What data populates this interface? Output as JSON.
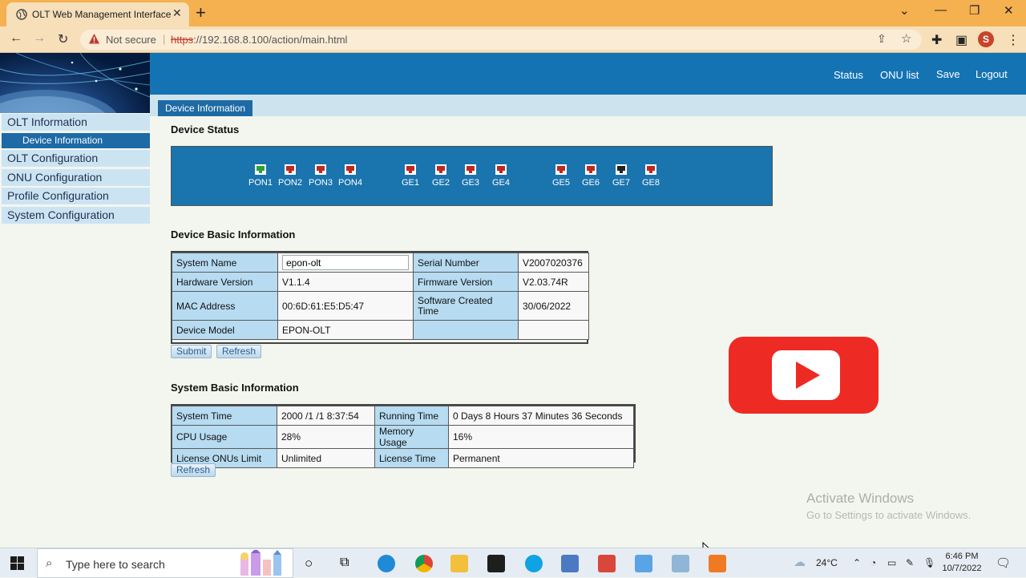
{
  "browser": {
    "tab_title": "OLT Web Management Interface",
    "new_tab": "+",
    "not_secure": "Not secure",
    "url_scheme": "https",
    "url_rest": "://192.168.8.100/action/main.html",
    "profile_initial": "S"
  },
  "header": {
    "links": [
      "Status",
      "ONU list",
      "Save",
      "Logout"
    ],
    "page_tab": "Device Information"
  },
  "sidebar": {
    "items": [
      {
        "label": "OLT Information"
      },
      {
        "label": "Device Information"
      },
      {
        "label": "OLT Configuration"
      },
      {
        "label": "ONU Configuration"
      },
      {
        "label": "Profile Configuration"
      },
      {
        "label": "System Configuration"
      }
    ]
  },
  "device_status": {
    "title": "Device Status",
    "ports": [
      {
        "label": "PON1",
        "state": "up",
        "color": "#2e9e3a"
      },
      {
        "label": "PON2",
        "state": "down",
        "color": "#c0281e"
      },
      {
        "label": "PON3",
        "state": "down",
        "color": "#c0281e"
      },
      {
        "label": "PON4",
        "state": "down",
        "color": "#c0281e"
      },
      {
        "label": "GE1",
        "state": "down",
        "color": "#c0281e"
      },
      {
        "label": "GE2",
        "state": "down",
        "color": "#c0281e"
      },
      {
        "label": "GE3",
        "state": "down",
        "color": "#c0281e"
      },
      {
        "label": "GE4",
        "state": "down",
        "color": "#c0281e"
      },
      {
        "label": "GE5",
        "state": "down",
        "color": "#c0281e"
      },
      {
        "label": "GE6",
        "state": "down",
        "color": "#c0281e"
      },
      {
        "label": "GE7",
        "state": "up",
        "color": "#222222"
      },
      {
        "label": "GE8",
        "state": "down",
        "color": "#c0281e"
      }
    ]
  },
  "device_basic": {
    "title": "Device Basic Information",
    "system_name_label": "System Name",
    "system_name_value": "epon-olt",
    "serial_label": "Serial Number",
    "serial_value": "V2007020376",
    "hw_label": "Hardware Version",
    "hw_value": "V1.1.4",
    "fw_label": "Firmware Version",
    "fw_value": "V2.03.74R",
    "mac_label": "MAC Address",
    "mac_value": "00:6D:61:E5:D5:47",
    "sw_created_label": "Software Created Time",
    "sw_created_value": "30/06/2022",
    "model_label": "Device Model",
    "model_value": "EPON-OLT",
    "submit": "Submit",
    "refresh": "Refresh"
  },
  "system_basic": {
    "title": "System Basic Information",
    "rows": [
      [
        "System Time",
        "2000 /1 /1 8:37:54",
        "Running Time",
        "0 Days 8 Hours 37 Minutes 36 Seconds"
      ],
      [
        "CPU Usage",
        "28%",
        "Memory Usage",
        "16%"
      ],
      [
        "License ONUs Limit",
        "Unlimited",
        "License Time",
        "Permanent"
      ]
    ],
    "refresh": "Refresh"
  },
  "watermark": {
    "line1": "Activate Windows",
    "line2": "Go to Settings to activate Windows."
  },
  "taskbar": {
    "search_placeholder": "Type here to search",
    "temperature": "24°C",
    "time": "6:46 PM",
    "date": "10/7/2022"
  }
}
